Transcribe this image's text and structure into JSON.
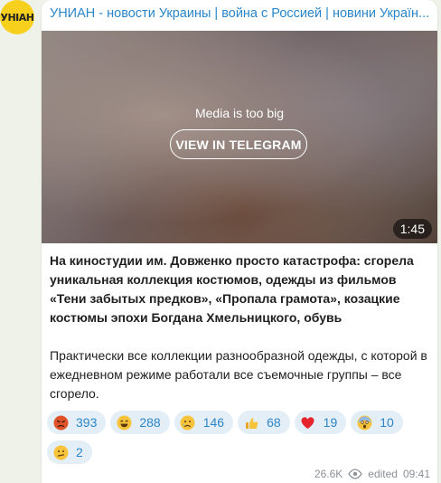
{
  "channel": {
    "avatar_text": "УНІАН",
    "title": "УНИАН - новости Украины | война с Россией | новини Україн..."
  },
  "media": {
    "note": "Media is too big",
    "view_button": "VIEW IN TELEGRAM",
    "duration": "1:45"
  },
  "message": {
    "lead": "На киностудии им. Довженко просто катастрофа: сгорела уникальная коллекция костюмов, одежды из фильмов «Тени забытых предков», «Пропала грамота», козацкие костюмы эпохи Богдана Хмельницкого, обувь",
    "body": "Практически все коллекции разнообразной одежды, с которой в ежедневном режиме работали все съемочные группы – все сгорело."
  },
  "reactions": [
    {
      "icon": "angry-face-icon",
      "count": "393"
    },
    {
      "icon": "grinning-face-icon",
      "count": "288"
    },
    {
      "icon": "crying-face-icon",
      "count": "146"
    },
    {
      "icon": "thumbs-up-icon",
      "count": "68"
    },
    {
      "icon": "heart-icon",
      "count": "19"
    },
    {
      "icon": "screaming-face-icon",
      "count": "10"
    },
    {
      "icon": "confused-face-icon",
      "count": "2"
    }
  ],
  "footer": {
    "views": "26.6K",
    "edited": "edited",
    "time": "09:41"
  },
  "colors": {
    "accent": "#2a86c8",
    "background": "#eef2e8",
    "reaction_bg": "#e4eef7"
  }
}
